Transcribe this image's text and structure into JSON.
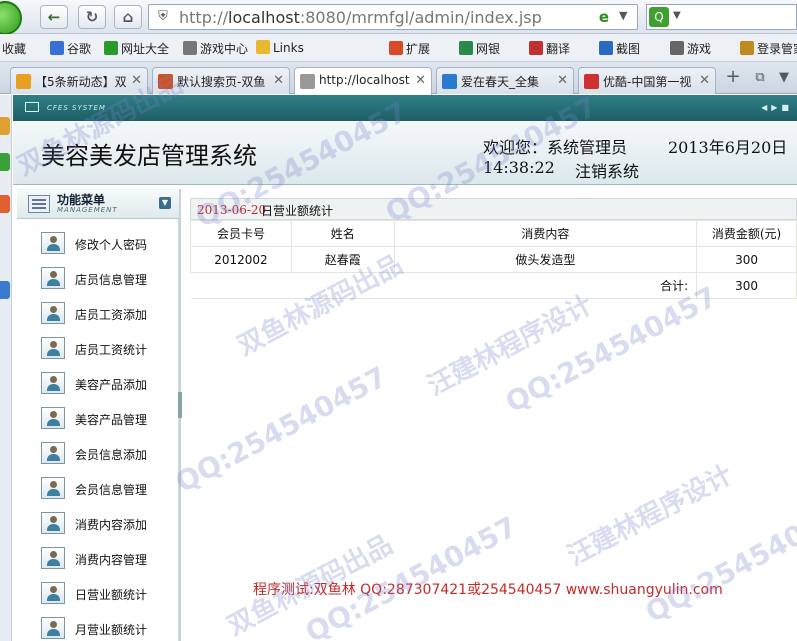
{
  "browser": {
    "url_prefix": "http://",
    "url_host": "localhost",
    "url_rest": ":8080/mrmfgl/admin/index.jsp",
    "bookmarks": [
      {
        "label": "收藏",
        "icon": "star-icon",
        "color": "#e0a000"
      },
      {
        "label": "谷歌",
        "icon": "google-icon",
        "color": "#3b6fd8"
      },
      {
        "label": "网址大全",
        "icon": "ie-icon",
        "color": "#2a9a2a"
      },
      {
        "label": "游戏中心",
        "icon": "gamepad-icon",
        "color": "#777777"
      },
      {
        "label": "Links",
        "icon": "folder-icon",
        "color": "#e8b830"
      },
      {
        "label": "扩展",
        "icon": "grid-icon",
        "color": "#d84a2a"
      },
      {
        "label": "网银",
        "icon": "bank-icon",
        "color": "#2a8a4a"
      },
      {
        "label": "翻译",
        "icon": "translate-icon",
        "color": "#c03030"
      },
      {
        "label": "截图",
        "icon": "scissors-icon",
        "color": "#2a6ac0"
      },
      {
        "label": "游戏",
        "icon": "gamepad-icon",
        "color": "#666666"
      },
      {
        "label": "登录管家",
        "icon": "key-icon",
        "color": "#c08a20"
      }
    ],
    "tabs": [
      {
        "label": "【5条新动态】双",
        "icon": "qzone-icon",
        "color": "#e8a020",
        "active": false
      },
      {
        "label": "默认搜索页-双鱼",
        "icon": "search-page-icon",
        "color": "#d05020",
        "active": false
      },
      {
        "label": "http://localhost",
        "icon": "page-icon",
        "color": "#999999",
        "active": true
      },
      {
        "label": "爱在春天_全集",
        "icon": "soku-icon",
        "color": "#2a7ad0",
        "active": false
      },
      {
        "label": "优酷-中国第一视",
        "icon": "youku-icon",
        "color": "#d03030",
        "active": false
      }
    ]
  },
  "system": {
    "strip_label": "CFES SYSTEM",
    "title": "美容美发店管理系统",
    "welcome": "欢迎您：系统管理员",
    "date": "2013年6月20日",
    "time": "14:38:22",
    "logout": "注销系统"
  },
  "sidebar": {
    "title": "功能菜单",
    "subtitle": "MANAGEMENT",
    "items": [
      {
        "label": "修改个人密码"
      },
      {
        "label": "店员信息管理"
      },
      {
        "label": "店员工资添加"
      },
      {
        "label": "店员工资统计"
      },
      {
        "label": "美容产品添加"
      },
      {
        "label": "美容产品管理"
      },
      {
        "label": "会员信息添加"
      },
      {
        "label": "会员信息管理"
      },
      {
        "label": "消费内容添加"
      },
      {
        "label": "消费内容管理"
      },
      {
        "label": "日营业额统计"
      },
      {
        "label": "月营业额统计"
      }
    ]
  },
  "content": {
    "date": "2013-06-20",
    "title": "日营业额统计",
    "columns": [
      "会员卡号",
      "姓名",
      "消费内容",
      "消费金额(元)"
    ],
    "rows": [
      {
        "card": "2012002",
        "name": "赵春霞",
        "item": "做头发造型",
        "amount": "300"
      }
    ],
    "total_label": "合计:",
    "total": "300"
  },
  "footer": {
    "note": "程序测试:双鱼林 QQ:287307421或254540457 www.shuangyulin.com"
  },
  "watermarks": {
    "qq": "QQ:254540457",
    "studio": "双鱼林源码出品",
    "designer": "汪建林程序设计",
    "tile_color": "#8082c8"
  }
}
